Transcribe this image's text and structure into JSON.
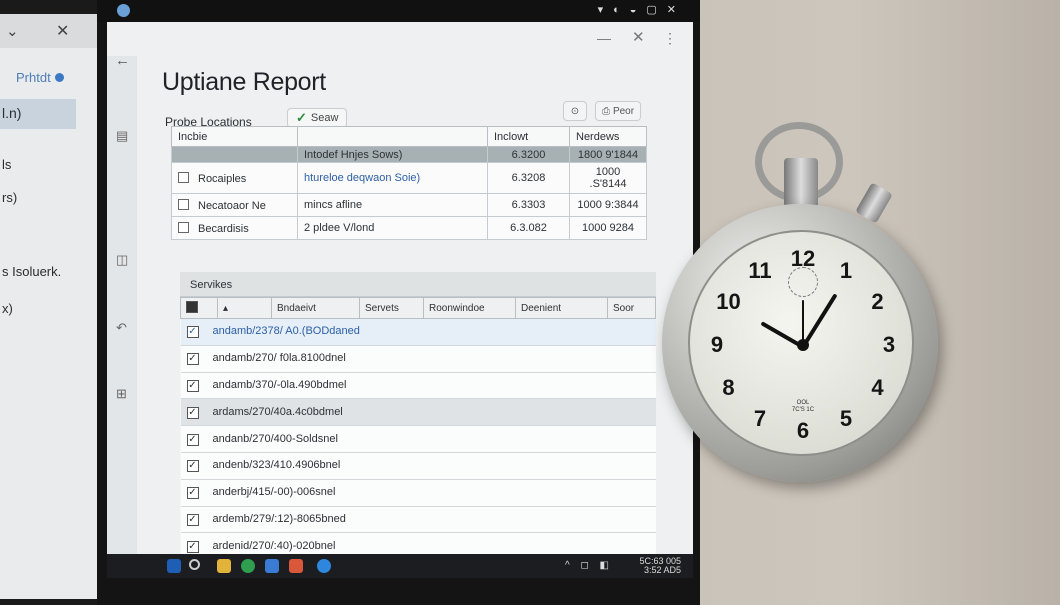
{
  "left_monitor": {
    "print_label": "Prhtdt",
    "selected_item": "l.n)",
    "items": [
      "ls",
      "rs)",
      "s Isoluerk.",
      "x)"
    ]
  },
  "window": {
    "title": "Uptiane Report",
    "minimize": "—",
    "close": "✕",
    "more": "⋮"
  },
  "toolbar": {
    "save_label": "Seaw",
    "refresh_icon": "refresh-icon",
    "print_label": "Peor"
  },
  "probe": {
    "label": "Probe Locations",
    "columns": [
      "Incbie",
      "",
      "Inclowt",
      "Nerdews"
    ],
    "selected_row": [
      "",
      "Intodef Hnjes Sows)",
      "6.3200",
      "1800 9'1844"
    ],
    "rows": [
      {
        "name": "Rocaiples",
        "target": "htureloe deqwaon Soie)",
        "value": "6.3208",
        "window": "1000 .S'8144"
      },
      {
        "name": "Necatoaor Ne",
        "target": "mincs afline",
        "value": "6.3303",
        "window": "1000 9:3844"
      },
      {
        "name": "Becardisis",
        "target": "2 pldee V/lond",
        "value": "6.3.082",
        "window": "1000 9284"
      }
    ]
  },
  "services": {
    "label": "Servikes",
    "columns": [
      "",
      "Bndaeivt",
      "Servets",
      "Roonwindoe",
      "Deenient",
      "Soor"
    ],
    "rows": [
      "andamb/2378/ A0.(BODdaned",
      "andamb/270/ f0la.8100dnel",
      "andamb/370/-0la.490bdmel",
      "ardams/270/40a.4c0bdmel",
      "andanb/270/400-Soldsnel",
      "andenb/323/410.4906bnel",
      "anderbj/415/-00)-006snel",
      "ardemb/279/:12)-8065bned",
      "ardenid/270/:40)-020bnel"
    ]
  },
  "taskbar": {
    "clock_time": "5C:63 005",
    "clock_date": "3:52 AD5"
  },
  "stopwatch": {
    "numerals": [
      "12",
      "1",
      "2",
      "3",
      "4",
      "5",
      "6",
      "7",
      "8",
      "9",
      "10",
      "11"
    ],
    "brand_line1": "OOL",
    "brand_line2": "7C'S 1C"
  }
}
